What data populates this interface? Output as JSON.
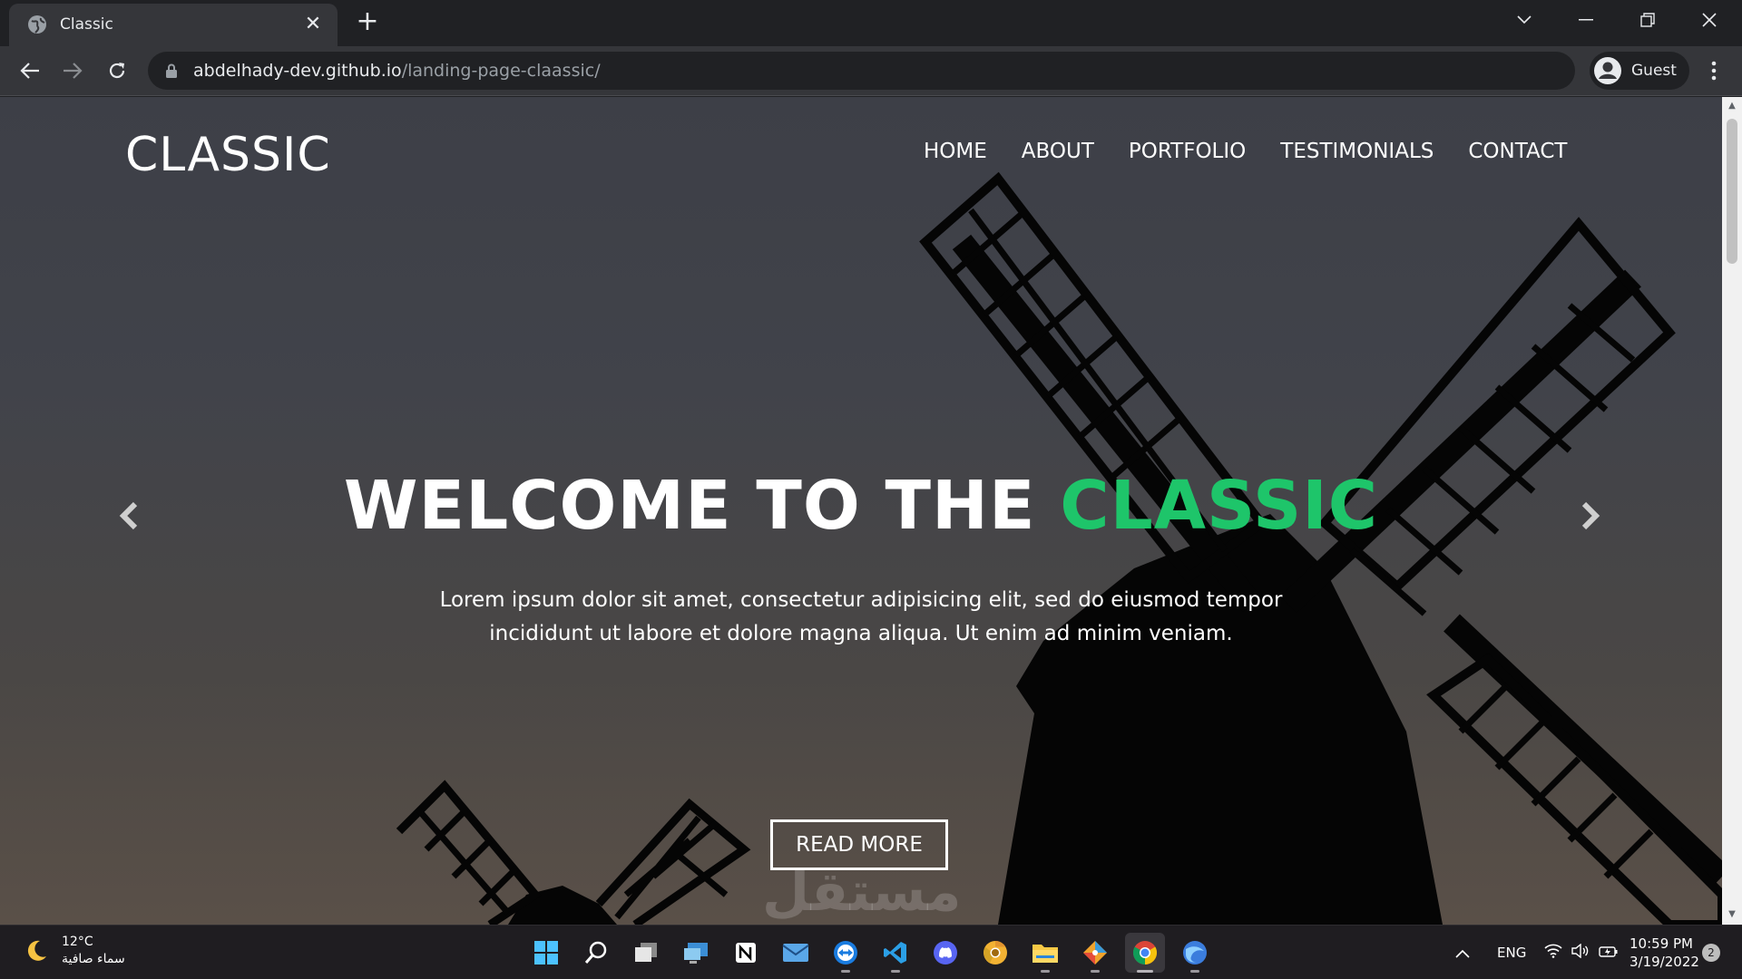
{
  "browser": {
    "tab": {
      "title": "Classic",
      "close_glyph": "✕",
      "favicon": "globe-icon"
    },
    "new_tab_glyph": "+",
    "url_host": "abdelhady-dev.github.io",
    "url_path": "/landing-page-claassic/",
    "profile_label": "Guest",
    "icons": [
      "back-arrow-icon",
      "forward-arrow-icon",
      "reload-icon",
      "lock-icon",
      "account-icon",
      "kebab-menu-icon"
    ]
  },
  "page": {
    "logo": "CLASSIC",
    "nav": [
      "HOME",
      "ABOUT",
      "PORTFOLIO",
      "TESTIMONIALS",
      "CONTACT"
    ],
    "hero": {
      "title_start": "WELCOME TO THE ",
      "title_accent": "CLASSIC",
      "text_line1": "Lorem ipsum dolor sit amet, consectetur adipisicing elit, sed do eiusmod tempor",
      "text_line2": "incididunt ut labore et dolore magna aliqua. Ut enim ad minim veniam.",
      "button": "READ MORE"
    },
    "accent_color": "#1ec56a",
    "watermark": "مستقل"
  },
  "taskbar": {
    "weather_temp": "12°C",
    "weather_desc": "سماء صافية",
    "lang": "ENG",
    "time": "10:59 PM",
    "date": "3/19/2022",
    "notifications": "2",
    "apps": [
      "windows-start-icon",
      "search-icon",
      "task-view-icon",
      "remote-desktop-icon",
      "notion-icon",
      "mail-icon",
      "teamviewer-icon",
      "vscode-icon",
      "discord-icon",
      "chrome-canary-icon",
      "file-explorer-icon",
      "git-icon",
      "chrome-icon",
      "browser-app-icon"
    ]
  }
}
